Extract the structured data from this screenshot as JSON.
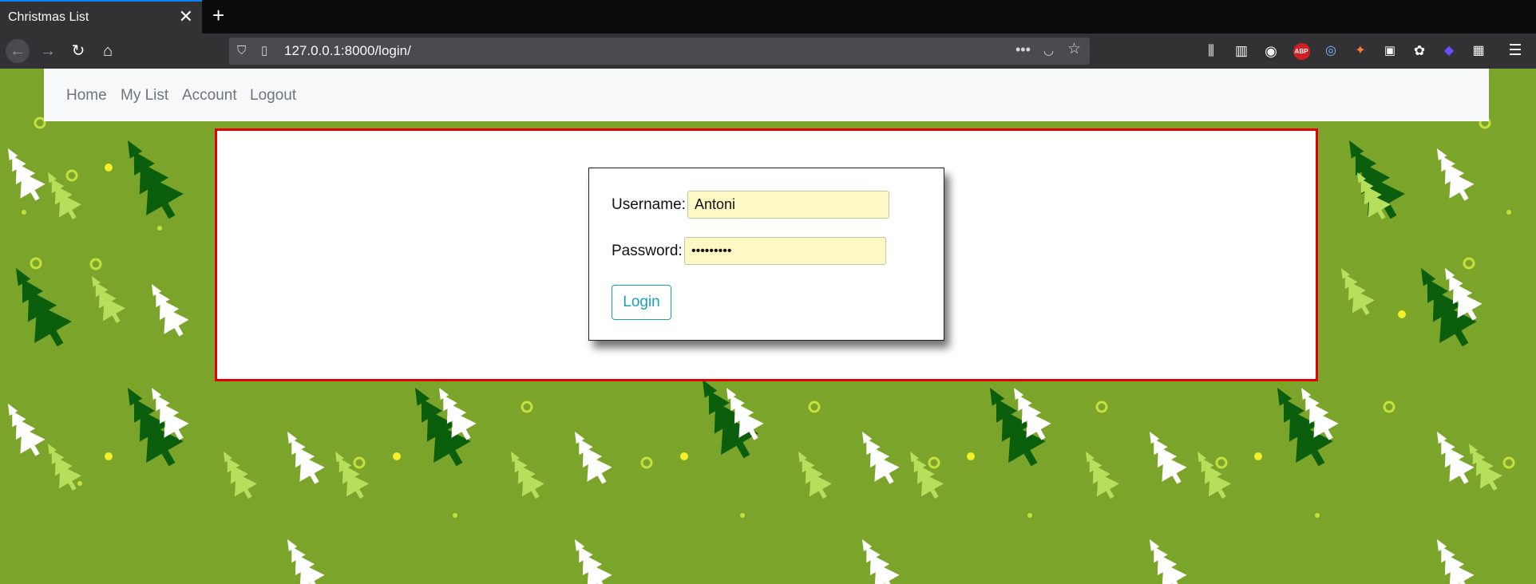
{
  "browser": {
    "tab_title": "Christmas List",
    "tab_close": "✕",
    "new_tab": "+",
    "url": "127.0.0.1:8000/login/",
    "icons": [
      "back-icon",
      "forward-icon",
      "reload-icon",
      "home-icon",
      "shield-icon",
      "page-icon",
      "more-icon",
      "pocket-icon",
      "star-icon",
      "library-icon",
      "sidebar-icon",
      "account-icon",
      "abp-icon",
      "extension-icon",
      "menu-icon"
    ],
    "abp_label": "ABP"
  },
  "navbar": {
    "links": [
      "Home",
      "My List",
      "Account",
      "Logout"
    ]
  },
  "login": {
    "username_label": "Username:",
    "username_value": "Antoni",
    "password_label": "Password:",
    "password_value": "•••••••••",
    "button_label": "Login"
  },
  "colors": {
    "background_green": "#7aa52a",
    "panel_border": "#e60000",
    "autofill_yellow": "#fdf9c4",
    "button_teal": "#17a2b8",
    "accent_blue": "#0a84ff"
  }
}
